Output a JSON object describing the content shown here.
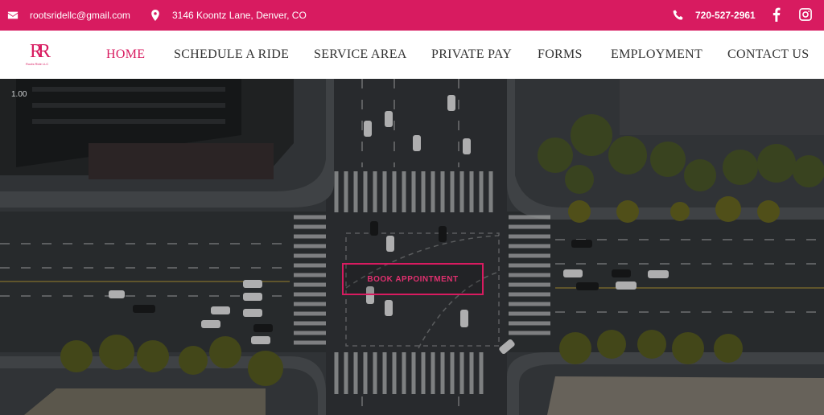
{
  "topbar": {
    "email": "rootsridellc@gmail.com",
    "address": "3146 Koontz Lane, Denver, CO",
    "phone": "720-527-2961",
    "icons": [
      "envelope-icon",
      "map-pin-icon",
      "phone-icon",
      "facebook-icon",
      "instagram-icon"
    ]
  },
  "logo": {
    "monogram": "RR",
    "tagline": "Roots Ride LLC"
  },
  "nav": {
    "items": [
      {
        "label": "HOME",
        "active": true
      },
      {
        "label": "SCHEDULE A RIDE",
        "active": false
      },
      {
        "label": "SERVICE AREA",
        "active": false
      },
      {
        "label": "PRIVATE PAY",
        "active": false
      },
      {
        "label": "FORMS",
        "active": false
      },
      {
        "label": "EMPLOYMENT",
        "active": false
      },
      {
        "label": "CONTACT US",
        "active": false
      }
    ]
  },
  "hero": {
    "zoom_label": "1.00",
    "cta_label": "BOOK APPOINTMENT"
  },
  "colors": {
    "brand": "#d81b60",
    "nav_text": "#333333",
    "white": "#ffffff"
  }
}
